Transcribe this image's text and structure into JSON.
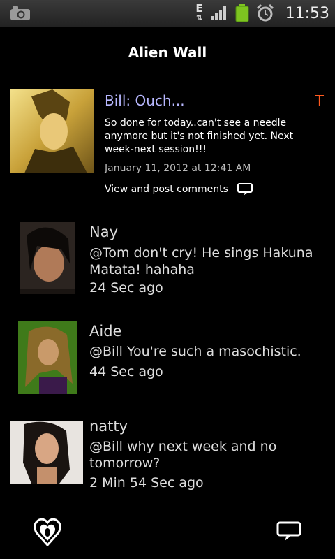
{
  "status_bar": {
    "time": "11:53",
    "network_type": "E",
    "icons": [
      "camera-icon",
      "edge-data-icon",
      "signal-icon",
      "battery-icon",
      "alarm-icon"
    ]
  },
  "header": {
    "title": "Alien Wall"
  },
  "post": {
    "title": "Bill: Ouch...",
    "marker": "T",
    "body": "So done for today..can't see a needle anymore but it's not finished yet. Next week-next session!!!",
    "date": "January 11, 2012 at 12:41 AM",
    "comments_link": "View and post comments"
  },
  "comments": [
    {
      "name": "Nay",
      "text": "@Tom don't cry! He sings Hakuna Matata! hahaha",
      "time": "24 Sec ago"
    },
    {
      "name": "Aide",
      "text": "@Bill You're such a masochistic.",
      "time": "44 Sec ago"
    },
    {
      "name": "natty",
      "text": "@Bill why next week and no tomorrow?",
      "time": "2 Min 54 Sec ago"
    }
  ],
  "colors": {
    "post_title": "#b8b8ff",
    "marker": "#ff5a1f",
    "background": "#000000",
    "status_bar": "#2a2a2a"
  }
}
